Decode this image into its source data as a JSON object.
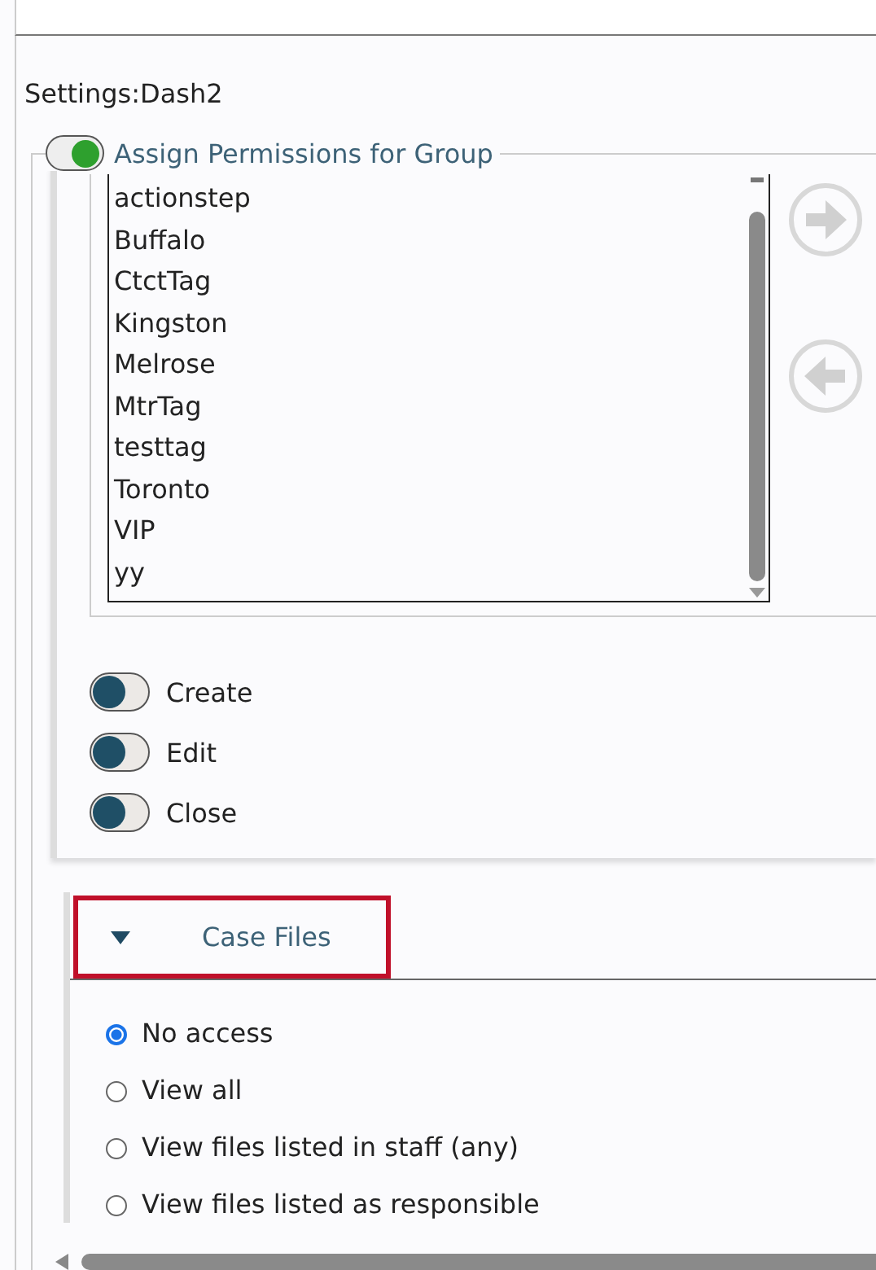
{
  "title": "Settings:Dash2",
  "group": {
    "label": "Assign Permissions for Group",
    "on": true
  },
  "list_items": [
    "actionstep",
    "Buffalo",
    "CtctTag",
    "Kingston",
    "Melrose",
    "MtrTag",
    "testtag",
    "Toronto",
    "VIP",
    "yy"
  ],
  "toggles": [
    {
      "label": "Create",
      "on": false
    },
    {
      "label": "Edit",
      "on": false
    },
    {
      "label": "Close",
      "on": false
    }
  ],
  "case_files": {
    "title": "Case Files",
    "expanded": true,
    "highlighted": true,
    "options": [
      {
        "label": "No access",
        "selected": true
      },
      {
        "label": "View all",
        "selected": false
      },
      {
        "label": "View files listed in staff (any)",
        "selected": false
      },
      {
        "label": "View files listed as responsible",
        "selected": false
      }
    ]
  }
}
